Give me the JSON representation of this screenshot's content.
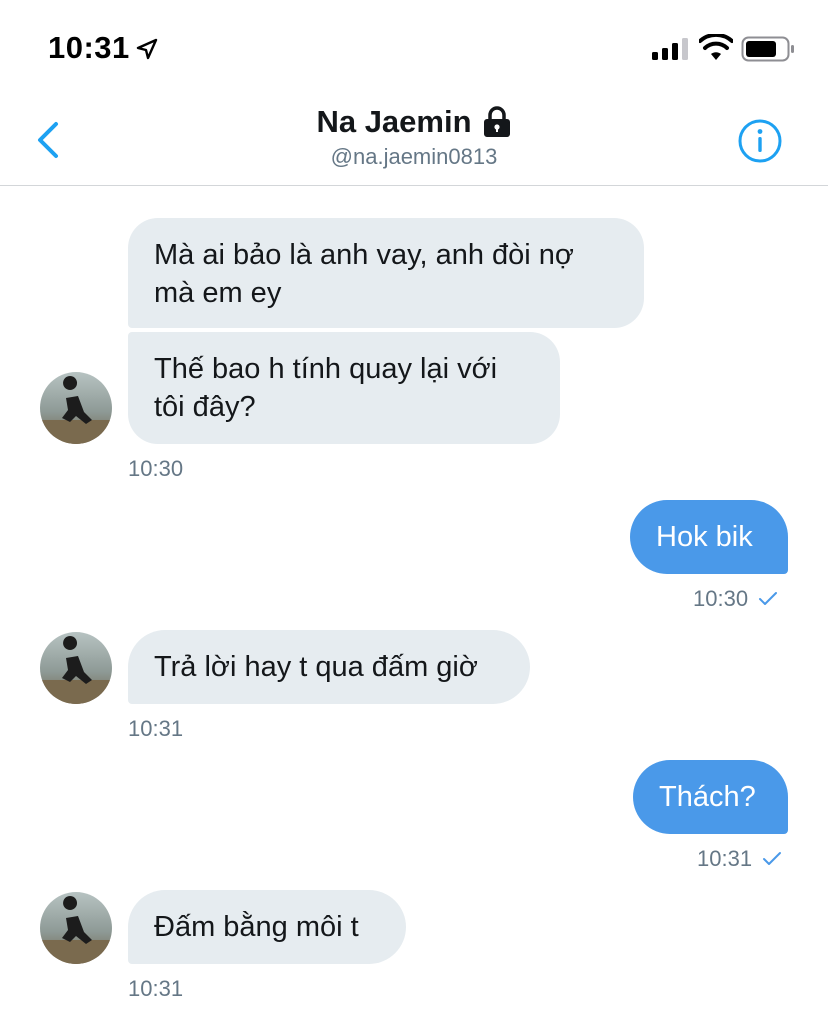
{
  "status_bar": {
    "time": "10:31",
    "icons": [
      "location-arrow-icon",
      "cellular-signal-icon",
      "wifi-icon",
      "battery-icon"
    ]
  },
  "header": {
    "name": "Na Jaemin",
    "handle": "@na.jaemin0813",
    "icons": [
      "back-chevron-icon",
      "lock-icon",
      "info-icon"
    ]
  },
  "colors": {
    "accent": "#1da1f2",
    "outgoing_bubble": "#4a99e9",
    "incoming_bubble": "#e6ecf0",
    "timestamp": "#657786"
  },
  "messages": [
    {
      "direction": "incoming",
      "text": "Mà ai bảo là anh vay, anh đòi nợ mà em ey"
    },
    {
      "direction": "incoming",
      "text": "Thế bao h tính quay lại với tôi đây?",
      "time": "10:30"
    },
    {
      "direction": "outgoing",
      "text": "Hok bik",
      "time": "10:30",
      "read": true
    },
    {
      "direction": "incoming",
      "text": "Trả lời hay t qua đấm giờ",
      "time": "10:31"
    },
    {
      "direction": "outgoing",
      "text": "Thách?",
      "time": "10:31",
      "read": true
    },
    {
      "direction": "incoming",
      "text": "Đấm bằng môi t",
      "time": "10:31"
    }
  ]
}
